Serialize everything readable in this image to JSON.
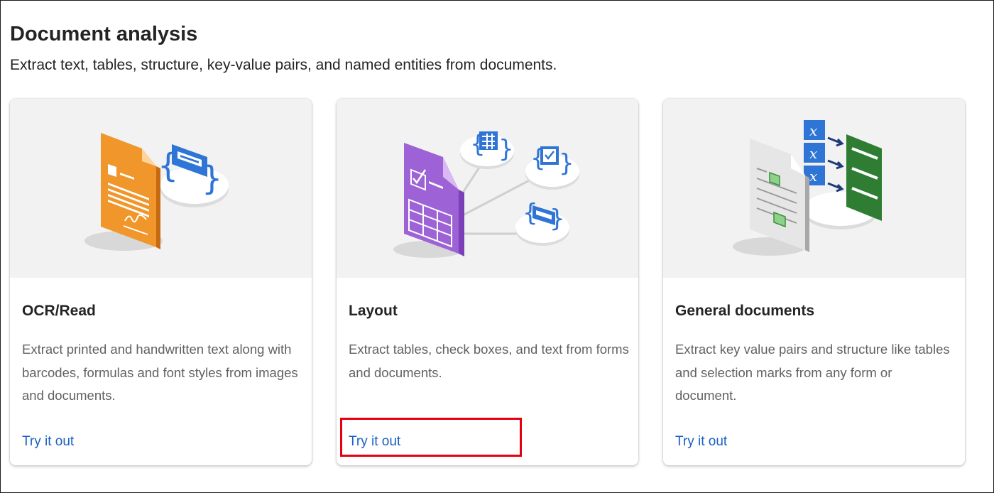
{
  "page": {
    "title": "Document analysis",
    "subtitle": "Extract text, tables, structure, key-value pairs, and named entities from documents."
  },
  "cards": [
    {
      "title": "OCR/Read",
      "description": "Extract printed and handwritten text along with barcodes, formulas and font styles from images and documents.",
      "link": "Try it out",
      "illustration": "ocr-document-icon"
    },
    {
      "title": "Layout",
      "description": "Extract tables, check boxes, and text from forms and documents.",
      "link": "Try it out",
      "illustration": "layout-document-icon"
    },
    {
      "title": "General documents",
      "description": "Extract key value pairs and structure like tables and selection marks from any form or document.",
      "link": "Try it out",
      "illustration": "general-document-icon"
    }
  ],
  "colors": {
    "link": "#1a5fc4",
    "highlight": "#e60012",
    "ocr_orange": "#f0962a",
    "layout_purple": "#9d62d6",
    "json_blue": "#2f75d6",
    "kv_green": "#2e7d32"
  }
}
